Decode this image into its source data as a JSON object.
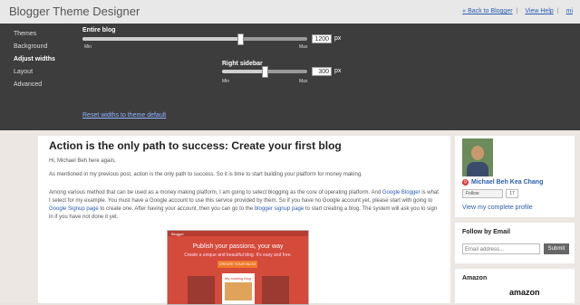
{
  "app": {
    "title": "Blogger Theme Designer",
    "links": {
      "back": "« Back to Blogger",
      "view_help": "View Help",
      "user": "mi"
    }
  },
  "nav": {
    "items": [
      {
        "label": "Themes",
        "active": false
      },
      {
        "label": "Background",
        "active": false
      },
      {
        "label": "Adjust widths",
        "active": true
      },
      {
        "label": "Layout",
        "active": false
      },
      {
        "label": "Advanced",
        "active": false
      }
    ]
  },
  "sliders": {
    "entire_blog": {
      "label": "Entire blog",
      "value": "1200",
      "unit": "px",
      "min_label": "Min",
      "max_label": "Max",
      "fraction": 0.7
    },
    "right_sidebar": {
      "label": "Right sidebar",
      "value": "300",
      "unit": "px",
      "min_label": "Min",
      "max_label": "Max",
      "fraction": 0.5
    }
  },
  "reset_link": "Reset widths to theme default",
  "post": {
    "title": "Action is the only path to success: Create your first blog",
    "greeting": "Hi, Michael Beh here again,",
    "para1": "As mentioned in my previous post, action is the only path to success. So it is time to start building your platform for money making.",
    "para2_a": "Among various method that can be used as a money making platform, I am going to select blogging as the core of operating platform. And ",
    "para2_link1": "Google Blogger",
    "para2_b": " is what I select for my example. You must have a Google account to use this service provided by them. So if you have no Google account yet, please start with going to ",
    "para2_link2": "Google Signup page",
    "para2_c": " to create one. After having your account, then you can go to the ",
    "para2_link3": "blogger signup page",
    "para2_d": " to start creating a blog. The system will ask you to sign in if you have not done it yet.",
    "image": {
      "brand": "Blogger",
      "headline": "Publish your passions, your way",
      "sub": "Create a unique and beautiful blog. It's easy and free.",
      "button": "CREATE YOUR BLOG",
      "card_title": "My cooking blog"
    }
  },
  "sidebar": {
    "profile": {
      "name": "Michael Beh Kea Chang",
      "follow_label": "Follow",
      "follow_count": "17",
      "view_profile": "View my complete profile"
    },
    "follow_by_email": {
      "title": "Follow by Email",
      "placeholder": "Email address...",
      "submit": "Submit"
    },
    "amazon": {
      "title": "Amazon",
      "logo": "amazon"
    }
  }
}
